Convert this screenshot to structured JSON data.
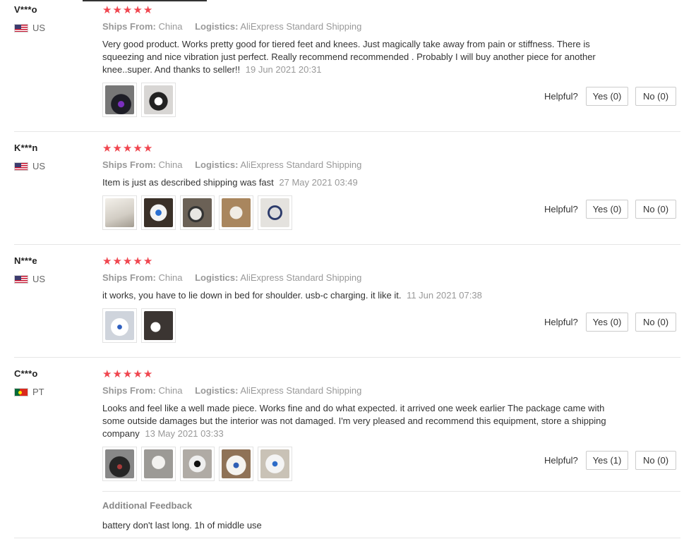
{
  "reviews": [
    {
      "user": "V***o",
      "country": "US",
      "flag": "us-flag",
      "stars": 5,
      "ships_from_label": "Ships From:",
      "ships_from": "China",
      "logistics_label": "Logistics:",
      "logistics": "AliExpress Standard Shipping",
      "text": "Very good product. Works pretty good for tiered feet and knees. Just magically take away from pain or stiffness. There is squeezing and nice vibration just perfect. Really recommend recommended . Probably I will buy another piece for another knee..super. And thanks to seller!!",
      "date": "19 Jun 2021 20:31",
      "helpful_label": "Helpful?",
      "yes": "Yes (0)",
      "no": "No (0)"
    },
    {
      "user": "K***n",
      "country": "US",
      "flag": "us-flag",
      "stars": 5,
      "ships_from_label": "Ships From:",
      "ships_from": "China",
      "logistics_label": "Logistics:",
      "logistics": "AliExpress Standard Shipping",
      "text": "Item is just as described shipping was fast",
      "date": "27 May 2021 03:49",
      "helpful_label": "Helpful?",
      "yes": "Yes (0)",
      "no": "No (0)"
    },
    {
      "user": "N***e",
      "country": "US",
      "flag": "us-flag",
      "stars": 5,
      "ships_from_label": "Ships From:",
      "ships_from": "China",
      "logistics_label": "Logistics:",
      "logistics": "AliExpress Standard Shipping",
      "text": "it works, you have to lie down in bed for shoulder. usb-c charging. it like it.",
      "date": "11 Jun 2021 07:38",
      "helpful_label": "Helpful?",
      "yes": "Yes (0)",
      "no": "No (0)"
    },
    {
      "user": "C***o",
      "country": "PT",
      "flag": "pt-flag",
      "stars": 5,
      "ships_from_label": "Ships From:",
      "ships_from": "China",
      "logistics_label": "Logistics:",
      "logistics": "AliExpress Standard Shipping",
      "text": "Looks and feel like a well made piece. Works fine and do what expected. it arrived one week earlier The package came with some outside damages but the interior was not damaged. I'm very pleased and recommend this equipment, store a shipping company",
      "date": "13 May 2021 03:33",
      "helpful_label": "Helpful?",
      "yes": "Yes (1)",
      "no": "No (0)",
      "additional_feedback_title": "Additional Feedback",
      "additional_feedback": "battery don't last long. 1h of middle use"
    }
  ],
  "star_glyph": "★",
  "star_color": "#f0464f"
}
